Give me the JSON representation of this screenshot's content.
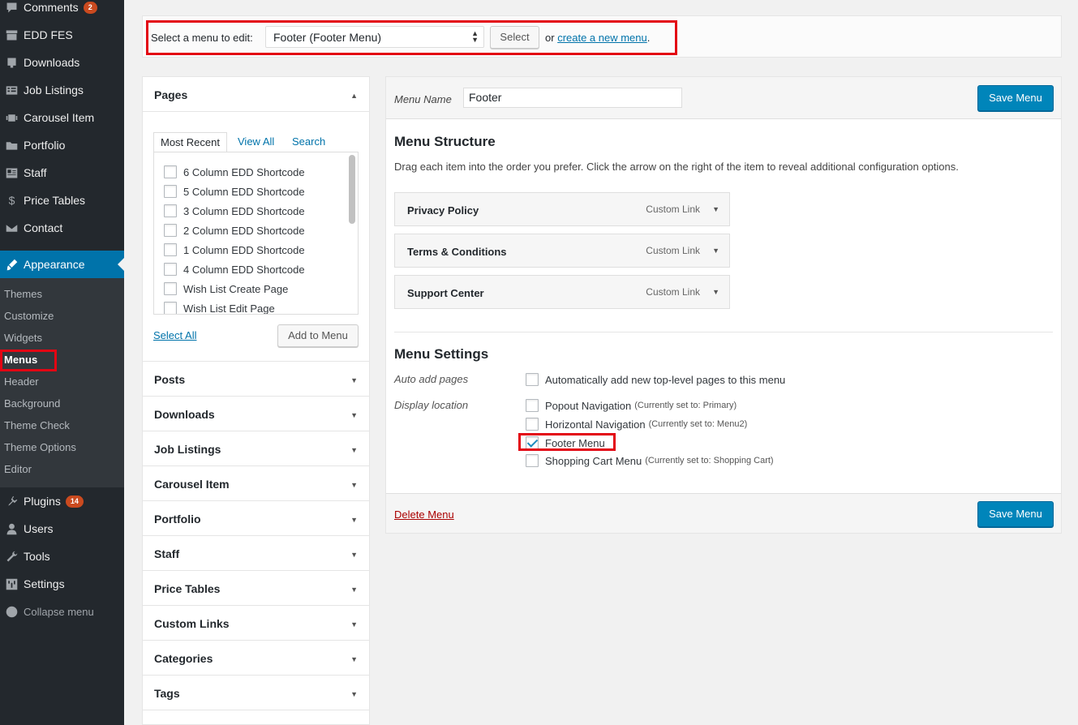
{
  "sidebar": {
    "items": [
      {
        "label": "Comments",
        "icon": "comment-icon",
        "badge": "2"
      },
      {
        "label": "EDD FES",
        "icon": "store-icon"
      },
      {
        "label": "Downloads",
        "icon": "download-icon"
      },
      {
        "label": "Job Listings",
        "icon": "list-icon"
      },
      {
        "label": "Carousel Item",
        "icon": "carousel-icon"
      },
      {
        "label": "Portfolio",
        "icon": "folder-icon"
      },
      {
        "label": "Staff",
        "icon": "id-card-icon"
      },
      {
        "label": "Price Tables",
        "icon": "dollar-icon"
      },
      {
        "label": "Contact",
        "icon": "mail-icon"
      }
    ],
    "appearance": {
      "label": "Appearance",
      "icon": "paintbrush-icon"
    },
    "submenu": [
      "Themes",
      "Customize",
      "Widgets",
      "Menus",
      "Header",
      "Background",
      "Theme Check",
      "Theme Options",
      "Editor"
    ],
    "lower_items": [
      {
        "label": "Plugins",
        "icon": "plugin-icon",
        "badge": "14"
      },
      {
        "label": "Users",
        "icon": "user-icon"
      },
      {
        "label": "Tools",
        "icon": "wrench-icon"
      },
      {
        "label": "Settings",
        "icon": "settings-icon"
      }
    ],
    "collapse": "Collapse menu"
  },
  "topbar": {
    "label": "Select a menu to edit:",
    "selected_menu": "Footer (Footer Menu)",
    "select_button": "Select",
    "or_text": "or",
    "create_link": "create a new menu",
    "period": "."
  },
  "pages_panel": {
    "title": "Pages",
    "tabs": [
      "Most Recent",
      "View All",
      "Search"
    ],
    "items": [
      "6 Column EDD Shortcode",
      "5 Column EDD Shortcode",
      "3 Column EDD Shortcode",
      "2 Column EDD Shortcode",
      "1 Column EDD Shortcode",
      "4 Column EDD Shortcode",
      "Wish List Create Page",
      "Wish List Edit Page"
    ],
    "select_all": "Select All",
    "add_button": "Add to Menu"
  },
  "accordion": [
    "Posts",
    "Downloads",
    "Job Listings",
    "Carousel Item",
    "Portfolio",
    "Staff",
    "Price Tables",
    "Custom Links",
    "Categories",
    "Tags"
  ],
  "editor": {
    "menu_name_label": "Menu Name",
    "menu_name_value": "Footer",
    "save_button": "Save Menu",
    "structure_title": "Menu Structure",
    "structure_desc": "Drag each item into the order you prefer. Click the arrow on the right of the item to reveal additional configuration options.",
    "menu_items": [
      {
        "title": "Privacy Policy",
        "kind": "Custom Link"
      },
      {
        "title": "Terms & Conditions",
        "kind": "Custom Link"
      },
      {
        "title": "Support Center",
        "kind": "Custom Link"
      }
    ],
    "settings_title": "Menu Settings",
    "auto_add_label": "Auto add pages",
    "auto_add_option": "Automatically add new top-level pages to this menu",
    "display_location_label": "Display location",
    "locations": [
      {
        "label": "Popout Navigation",
        "current": "(Currently set to: Primary)",
        "checked": false
      },
      {
        "label": "Horizontal Navigation",
        "current": "(Currently set to: Menu2)",
        "checked": false
      },
      {
        "label": "Footer Menu",
        "current": "",
        "checked": true
      },
      {
        "label": "Shopping Cart Menu",
        "current": "(Currently set to: Shopping Cart)",
        "checked": false
      }
    ],
    "delete_link": "Delete Menu"
  },
  "colors": {
    "sidebar_bg": "#23282d",
    "accent": "#0073aa",
    "primary_button": "#0085ba",
    "highlight_box": "#e30613"
  }
}
